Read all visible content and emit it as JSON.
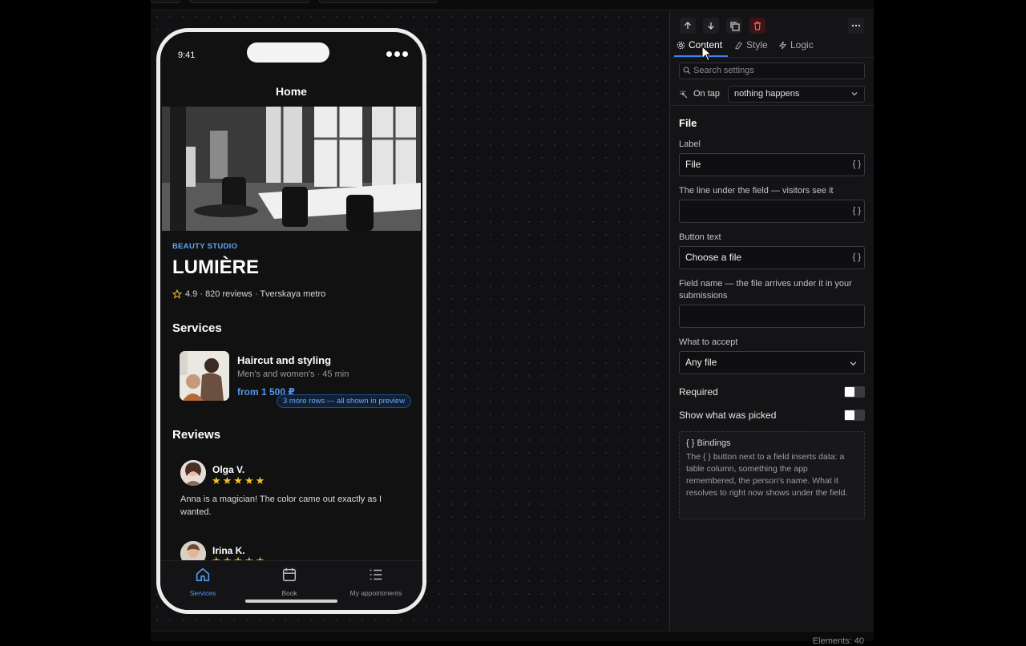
{
  "phone": {
    "status_time": "9:41",
    "nav_title": "Home",
    "kicker": "BEAUTY STUDIO",
    "brand": "LUMIÈRE",
    "meta": "4.9 · 820 reviews · Tverskaya metro",
    "services_heading": "Services",
    "service": {
      "name": "Haircut and styling",
      "subtitle": "Men's and women's · 45 min",
      "price": "from 1 500 ₽"
    },
    "more_rows_pill": "3 more rows — all shown in preview",
    "reviews_heading": "Reviews",
    "reviews": [
      {
        "name": "Olga V.",
        "stars": "★★★★★",
        "text": "Anna is a magician! The color came out exactly as I wanted."
      },
      {
        "name": "Irina K.",
        "stars": "★★★★★",
        "text": ""
      }
    ],
    "tabs": [
      {
        "label": "Services",
        "icon": "home-icon",
        "active": true
      },
      {
        "label": "Book",
        "icon": "calendar-icon",
        "active": false
      },
      {
        "label": "My appointments",
        "icon": "list-icon",
        "active": false
      }
    ]
  },
  "panel": {
    "toolbar": [
      "arrow-up-icon",
      "arrow-down-icon",
      "duplicate-icon",
      "trash-icon",
      "more-icon"
    ],
    "tabs": [
      "Content",
      "Style",
      "Logic"
    ],
    "search_placeholder": "Search settings",
    "on_tap_label": "On tap",
    "on_tap_value": "nothing happens",
    "title": "File",
    "fields": {
      "label_label": "Label",
      "label_value": "File",
      "helper_label": "The line under the field — visitors see it",
      "helper_value": "",
      "button_text_label": "Button text",
      "button_text_value": "Choose a file",
      "field_name_label": "Field name — the file arrives under it in your submissions",
      "field_name_value": "",
      "accept_label": "What to accept",
      "accept_value": "Any file"
    },
    "braces": "{ }",
    "required_label": "Required",
    "show_picked_label": "Show what was picked",
    "bindings_title": "{ } Bindings",
    "bindings_text": "The { } button next to a field inserts data: a table column, something the app remembered, the person's name. What it resolves to right now shows under the field."
  },
  "footer": {
    "elements_count": "Elements: 40"
  }
}
